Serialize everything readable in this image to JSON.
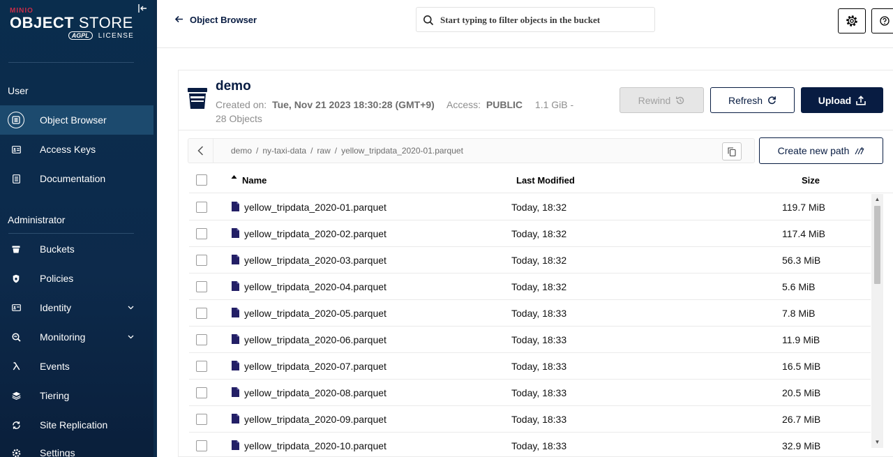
{
  "brand": {
    "minio": "MINIO",
    "product_bold": "OBJECT",
    "product_light": "STORE",
    "agpl": "AGPL",
    "license": "LICENSE"
  },
  "sidebar": {
    "user_section": "User",
    "user_items": [
      {
        "label": "Object Browser",
        "icon": "object-browser-icon",
        "active": true
      },
      {
        "label": "Access Keys",
        "icon": "access-keys-icon"
      },
      {
        "label": "Documentation",
        "icon": "documentation-icon"
      }
    ],
    "admin_section": "Administrator",
    "admin_items": [
      {
        "label": "Buckets",
        "icon": "buckets-icon"
      },
      {
        "label": "Policies",
        "icon": "policies-icon"
      },
      {
        "label": "Identity",
        "icon": "identity-icon",
        "expandable": true
      },
      {
        "label": "Monitoring",
        "icon": "monitoring-icon",
        "expandable": true
      },
      {
        "label": "Events",
        "icon": "lambda-icon"
      },
      {
        "label": "Tiering",
        "icon": "tiering-icon"
      },
      {
        "label": "Site Replication",
        "icon": "replication-icon"
      },
      {
        "label": "Settings",
        "icon": "settings-icon"
      }
    ]
  },
  "topbar": {
    "back_label": "Object Browser",
    "search_placeholder": "Start typing to filter objects in the bucket"
  },
  "bucket": {
    "name": "demo",
    "created_label": "Created on:",
    "created_value": "Tue, Nov 21 2023 18:30:28 (GMT+9)",
    "access_label": "Access:",
    "access_value": "PUBLIC",
    "usage": "1.1 GiB -",
    "objects": "28 Objects",
    "rewind_label": "Rewind",
    "refresh_label": "Refresh",
    "upload_label": "Upload"
  },
  "breadcrumb": {
    "parts": [
      "demo",
      "ny-taxi-data",
      "raw",
      "yellow_tripdata_2020-01.parquet"
    ],
    "separator": "/"
  },
  "new_path_label": "Create new path",
  "table": {
    "columns": {
      "name": "Name",
      "modified": "Last Modified",
      "size": "Size"
    },
    "rows": [
      {
        "name": "yellow_tripdata_2020-01.parquet",
        "modified": "Today, 18:32",
        "size": "119.7 MiB"
      },
      {
        "name": "yellow_tripdata_2020-02.parquet",
        "modified": "Today, 18:32",
        "size": "117.4 MiB"
      },
      {
        "name": "yellow_tripdata_2020-03.parquet",
        "modified": "Today, 18:32",
        "size": "56.3 MiB"
      },
      {
        "name": "yellow_tripdata_2020-04.parquet",
        "modified": "Today, 18:32",
        "size": "5.6 MiB"
      },
      {
        "name": "yellow_tripdata_2020-05.parquet",
        "modified": "Today, 18:33",
        "size": "7.8 MiB"
      },
      {
        "name": "yellow_tripdata_2020-06.parquet",
        "modified": "Today, 18:33",
        "size": "11.9 MiB"
      },
      {
        "name": "yellow_tripdata_2020-07.parquet",
        "modified": "Today, 18:33",
        "size": "16.5 MiB"
      },
      {
        "name": "yellow_tripdata_2020-08.parquet",
        "modified": "Today, 18:33",
        "size": "20.5 MiB"
      },
      {
        "name": "yellow_tripdata_2020-09.parquet",
        "modified": "Today, 18:33",
        "size": "26.7 MiB"
      },
      {
        "name": "yellow_tripdata_2020-10.parquet",
        "modified": "Today, 18:33",
        "size": "32.9 MiB"
      }
    ]
  },
  "colors": {
    "sidebar_bg": "#0d2a4b",
    "primary": "#081c42",
    "file_icon": "#231f66"
  }
}
